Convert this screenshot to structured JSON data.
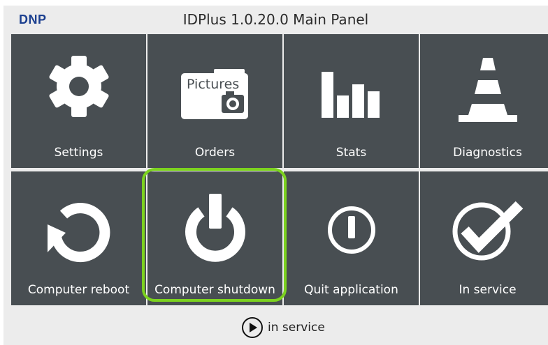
{
  "app": {
    "brand": "DNP",
    "title": "IDPlus 1.0.20.0 Main Panel"
  },
  "tiles": [
    {
      "label": "Settings",
      "icon": "gear-icon"
    },
    {
      "label": "Orders",
      "icon": "pictures-camera-icon",
      "icon_text": "Pictures"
    },
    {
      "label": "Stats",
      "icon": "bar-chart-icon"
    },
    {
      "label": "Diagnostics",
      "icon": "traffic-cone-icon"
    },
    {
      "label": "Computer reboot",
      "icon": "reboot-icon"
    },
    {
      "label": "Computer shutdown",
      "icon": "power-icon",
      "highlighted": true
    },
    {
      "label": "Quit application",
      "icon": "quit-icon"
    },
    {
      "label": "In service",
      "icon": "checkmark-icon"
    }
  ],
  "status": {
    "text": "in service",
    "icon": "play-circle-icon"
  },
  "colors": {
    "tile_bg": "#484e52",
    "window_bg": "#ececec",
    "highlight": "#7cd21f",
    "brand": "#1b3f8f"
  }
}
